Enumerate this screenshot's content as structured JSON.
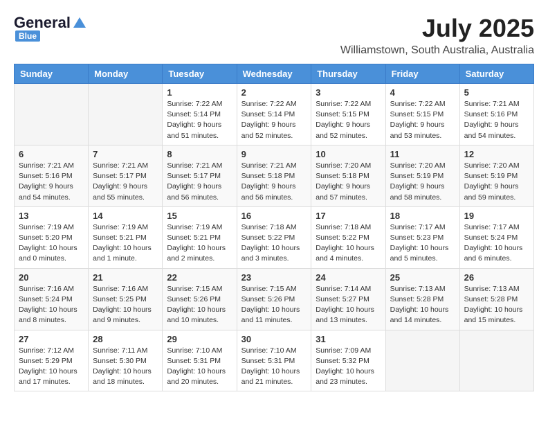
{
  "header": {
    "logo_general": "General",
    "logo_blue": "Blue",
    "month": "July 2025",
    "location": "Williamstown, South Australia, Australia"
  },
  "weekdays": [
    "Sunday",
    "Monday",
    "Tuesday",
    "Wednesday",
    "Thursday",
    "Friday",
    "Saturday"
  ],
  "weeks": [
    [
      {
        "day": "",
        "info": ""
      },
      {
        "day": "",
        "info": ""
      },
      {
        "day": "1",
        "info": "Sunrise: 7:22 AM\nSunset: 5:14 PM\nDaylight: 9 hours\nand 51 minutes."
      },
      {
        "day": "2",
        "info": "Sunrise: 7:22 AM\nSunset: 5:14 PM\nDaylight: 9 hours\nand 52 minutes."
      },
      {
        "day": "3",
        "info": "Sunrise: 7:22 AM\nSunset: 5:15 PM\nDaylight: 9 hours\nand 52 minutes."
      },
      {
        "day": "4",
        "info": "Sunrise: 7:22 AM\nSunset: 5:15 PM\nDaylight: 9 hours\nand 53 minutes."
      },
      {
        "day": "5",
        "info": "Sunrise: 7:21 AM\nSunset: 5:16 PM\nDaylight: 9 hours\nand 54 minutes."
      }
    ],
    [
      {
        "day": "6",
        "info": "Sunrise: 7:21 AM\nSunset: 5:16 PM\nDaylight: 9 hours\nand 54 minutes."
      },
      {
        "day": "7",
        "info": "Sunrise: 7:21 AM\nSunset: 5:17 PM\nDaylight: 9 hours\nand 55 minutes."
      },
      {
        "day": "8",
        "info": "Sunrise: 7:21 AM\nSunset: 5:17 PM\nDaylight: 9 hours\nand 56 minutes."
      },
      {
        "day": "9",
        "info": "Sunrise: 7:21 AM\nSunset: 5:18 PM\nDaylight: 9 hours\nand 56 minutes."
      },
      {
        "day": "10",
        "info": "Sunrise: 7:20 AM\nSunset: 5:18 PM\nDaylight: 9 hours\nand 57 minutes."
      },
      {
        "day": "11",
        "info": "Sunrise: 7:20 AM\nSunset: 5:19 PM\nDaylight: 9 hours\nand 58 minutes."
      },
      {
        "day": "12",
        "info": "Sunrise: 7:20 AM\nSunset: 5:19 PM\nDaylight: 9 hours\nand 59 minutes."
      }
    ],
    [
      {
        "day": "13",
        "info": "Sunrise: 7:19 AM\nSunset: 5:20 PM\nDaylight: 10 hours\nand 0 minutes."
      },
      {
        "day": "14",
        "info": "Sunrise: 7:19 AM\nSunset: 5:21 PM\nDaylight: 10 hours\nand 1 minute."
      },
      {
        "day": "15",
        "info": "Sunrise: 7:19 AM\nSunset: 5:21 PM\nDaylight: 10 hours\nand 2 minutes."
      },
      {
        "day": "16",
        "info": "Sunrise: 7:18 AM\nSunset: 5:22 PM\nDaylight: 10 hours\nand 3 minutes."
      },
      {
        "day": "17",
        "info": "Sunrise: 7:18 AM\nSunset: 5:22 PM\nDaylight: 10 hours\nand 4 minutes."
      },
      {
        "day": "18",
        "info": "Sunrise: 7:17 AM\nSunset: 5:23 PM\nDaylight: 10 hours\nand 5 minutes."
      },
      {
        "day": "19",
        "info": "Sunrise: 7:17 AM\nSunset: 5:24 PM\nDaylight: 10 hours\nand 6 minutes."
      }
    ],
    [
      {
        "day": "20",
        "info": "Sunrise: 7:16 AM\nSunset: 5:24 PM\nDaylight: 10 hours\nand 8 minutes."
      },
      {
        "day": "21",
        "info": "Sunrise: 7:16 AM\nSunset: 5:25 PM\nDaylight: 10 hours\nand 9 minutes."
      },
      {
        "day": "22",
        "info": "Sunrise: 7:15 AM\nSunset: 5:26 PM\nDaylight: 10 hours\nand 10 minutes."
      },
      {
        "day": "23",
        "info": "Sunrise: 7:15 AM\nSunset: 5:26 PM\nDaylight: 10 hours\nand 11 minutes."
      },
      {
        "day": "24",
        "info": "Sunrise: 7:14 AM\nSunset: 5:27 PM\nDaylight: 10 hours\nand 13 minutes."
      },
      {
        "day": "25",
        "info": "Sunrise: 7:13 AM\nSunset: 5:28 PM\nDaylight: 10 hours\nand 14 minutes."
      },
      {
        "day": "26",
        "info": "Sunrise: 7:13 AM\nSunset: 5:28 PM\nDaylight: 10 hours\nand 15 minutes."
      }
    ],
    [
      {
        "day": "27",
        "info": "Sunrise: 7:12 AM\nSunset: 5:29 PM\nDaylight: 10 hours\nand 17 minutes."
      },
      {
        "day": "28",
        "info": "Sunrise: 7:11 AM\nSunset: 5:30 PM\nDaylight: 10 hours\nand 18 minutes."
      },
      {
        "day": "29",
        "info": "Sunrise: 7:10 AM\nSunset: 5:31 PM\nDaylight: 10 hours\nand 20 minutes."
      },
      {
        "day": "30",
        "info": "Sunrise: 7:10 AM\nSunset: 5:31 PM\nDaylight: 10 hours\nand 21 minutes."
      },
      {
        "day": "31",
        "info": "Sunrise: 7:09 AM\nSunset: 5:32 PM\nDaylight: 10 hours\nand 23 minutes."
      },
      {
        "day": "",
        "info": ""
      },
      {
        "day": "",
        "info": ""
      }
    ]
  ]
}
